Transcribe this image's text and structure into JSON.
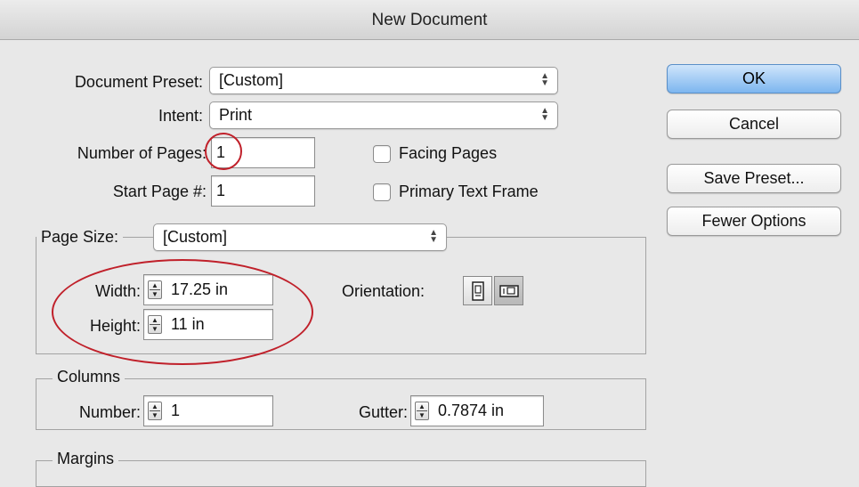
{
  "dialog": {
    "title": "New Document"
  },
  "document_preset": {
    "label": "Document Preset:",
    "value": "[Custom]"
  },
  "intent": {
    "label": "Intent:",
    "value": "Print"
  },
  "number_of_pages": {
    "label": "Number of Pages:",
    "value": "1"
  },
  "start_page": {
    "label": "Start Page #:",
    "value": "1"
  },
  "facing_pages": {
    "label": "Facing Pages",
    "checked": false
  },
  "primary_text_frame": {
    "label": "Primary Text Frame",
    "checked": false
  },
  "page_size": {
    "label": "Page Size:",
    "value": "[Custom]",
    "width_label": "Width:",
    "width_value": "17.25 in",
    "height_label": "Height:",
    "height_value": "11 in",
    "orientation_label": "Orientation:",
    "orientation_selected": "landscape"
  },
  "columns": {
    "group_label": "Columns",
    "number_label": "Number:",
    "number_value": "1",
    "gutter_label": "Gutter:",
    "gutter_value": "0.7874 in"
  },
  "margins": {
    "group_label": "Margins"
  },
  "buttons": {
    "ok": "OK",
    "cancel": "Cancel",
    "save_preset": "Save Preset...",
    "fewer_options": "Fewer Options"
  },
  "icons": {
    "portrait": "portrait-orientation-icon",
    "landscape": "landscape-orientation-icon",
    "stepper": "stepper-arrows-icon",
    "select_arrows": "updown-arrows-icon"
  },
  "annotation_color": "#c0202a"
}
